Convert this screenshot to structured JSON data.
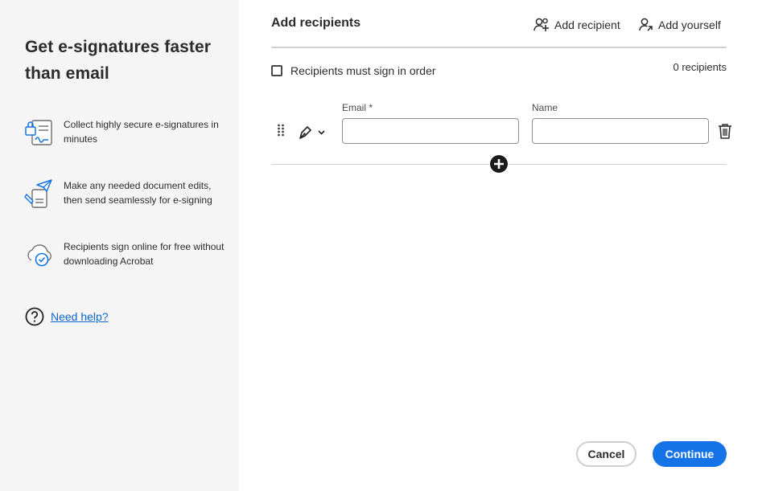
{
  "left_panel": {
    "title": "Get e-signatures faster than email",
    "features": [
      {
        "icon": "secure-signature-icon",
        "text": "Collect highly secure e-signatures in minutes"
      },
      {
        "icon": "edit-send-icon",
        "text": "Make any needed document edits, then send seamlessly for e-signing"
      },
      {
        "icon": "cloud-check-icon",
        "text": "Recipients sign online for free without downloading Acrobat"
      }
    ],
    "help": {
      "icon": "question-circle-icon",
      "label": "Need help?"
    }
  },
  "main": {
    "title": "Add recipients",
    "add_recipient_label": "Add recipient",
    "add_yourself_label": "Add yourself",
    "sign_in_order_label": "Recipients must sign in order",
    "recipient_count": "0 recipients",
    "recipient_row": {
      "email_label": "Email",
      "required_marker": "*",
      "name_label": "Name",
      "email_value": "",
      "name_value": ""
    }
  },
  "footer": {
    "cancel_label": "Cancel",
    "continue_label": "Continue"
  },
  "colors": {
    "accent": "#1473e6",
    "link": "#0d66d0",
    "left_background": "#f5f5f5"
  }
}
